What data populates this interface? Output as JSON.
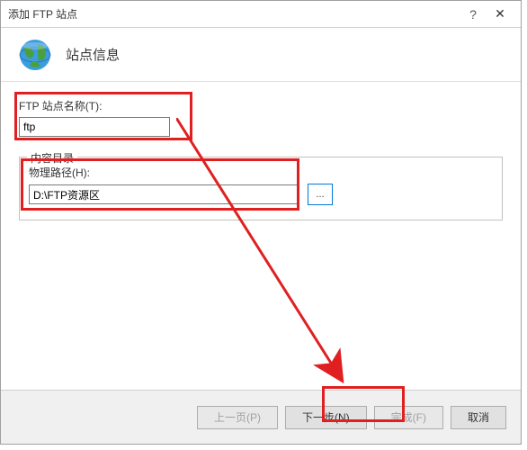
{
  "titlebar": {
    "title": "添加 FTP 站点",
    "help": "?",
    "close": "✕"
  },
  "header": {
    "title": "站点信息"
  },
  "fields": {
    "siteNameLabel": "FTP 站点名称(T):",
    "siteNameValue": "ftp",
    "contentDirLegend": "内容目录",
    "physicalPathLabel": "物理路径(H):",
    "physicalPathValue": "D:\\FTP资源区",
    "browseBtn": "..."
  },
  "footer": {
    "prev": "上一页(P)",
    "next": "下一步(N)",
    "finish": "完成(F)",
    "cancel": "取消"
  }
}
